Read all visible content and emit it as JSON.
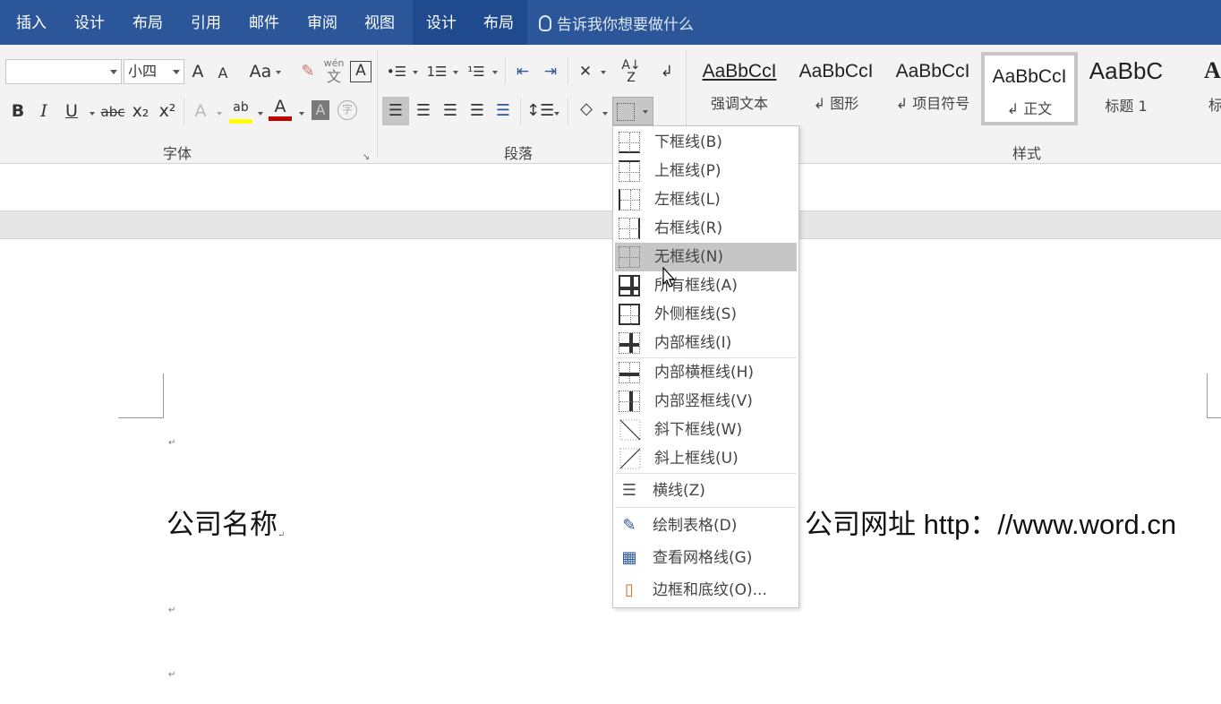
{
  "tabs": {
    "insert": "插入",
    "design": "设计",
    "layout": "布局",
    "references": "引用",
    "mailings": "邮件",
    "review": "审阅",
    "view": "视图",
    "table_design": "设计",
    "table_layout": "布局",
    "tell_me": "告诉我你想要做什么"
  },
  "ribbon": {
    "font_name": "",
    "font_size": "小四",
    "groups": {
      "font": "字体",
      "paragraph": "段落",
      "styles": "样式"
    },
    "font_buttons": {
      "bold": "B",
      "italic": "I",
      "underline": "U",
      "strike": "abc",
      "subscript": "x₂",
      "superscript": "x²",
      "grow": "A",
      "shrink": "A",
      "change_case": "Aa",
      "phonetic_top": "wén",
      "phonetic_bottom": "文",
      "char_border": "A",
      "text_effect": "A",
      "highlight": "ab",
      "font_color": "A",
      "char_shading": "A",
      "enclose": "字"
    }
  },
  "styles": [
    {
      "sample": "AaBbCcI",
      "name": "强调文本",
      "selected": false
    },
    {
      "sample": "AaBbCcI",
      "name": "↲ 图形",
      "selected": false
    },
    {
      "sample": "AaBbCcI",
      "name": "↲ 项目符号",
      "selected": false
    },
    {
      "sample": "AaBbCcI",
      "name": "↲ 正文",
      "selected": true
    },
    {
      "sample": "AaBbC",
      "name": "标题 1",
      "selected": false
    },
    {
      "sample": "AaI",
      "name": "标题",
      "selected": false
    }
  ],
  "border_menu": {
    "items": [
      {
        "label": "下框线(B)",
        "icon": "bottom-border-icon"
      },
      {
        "label": "上框线(P)",
        "icon": "top-border-icon"
      },
      {
        "label": "左框线(L)",
        "icon": "left-border-icon"
      },
      {
        "label": "右框线(R)",
        "icon": "right-border-icon"
      },
      {
        "label": "无框线(N)",
        "icon": "no-border-icon",
        "highlighted": true
      },
      {
        "label": "所有框线(A)",
        "icon": "all-borders-icon"
      },
      {
        "label": "外侧框线(S)",
        "icon": "outside-borders-icon"
      },
      {
        "label": "内部框线(I)",
        "icon": "inside-borders-icon"
      },
      {
        "label": "内部横框线(H)",
        "icon": "inside-horizontal-border-icon"
      },
      {
        "label": "内部竖框线(V)",
        "icon": "inside-vertical-border-icon"
      },
      {
        "label": "斜下框线(W)",
        "icon": "diagonal-down-border-icon"
      },
      {
        "label": "斜上框线(U)",
        "icon": "diagonal-up-border-icon"
      },
      {
        "label": "横线(Z)",
        "icon": "horizontal-line-icon"
      },
      {
        "label": "绘制表格(D)",
        "icon": "draw-table-icon"
      },
      {
        "label": "查看网格线(G)",
        "icon": "view-gridlines-icon"
      },
      {
        "label": "边框和底纹(O)...",
        "icon": "borders-shading-icon"
      }
    ]
  },
  "document": {
    "company_name": "公司名称",
    "company_site_label": "公司网址",
    "company_site_url": " http：//www.word.cn",
    "para_mark": "↵"
  },
  "colors": {
    "title_bar": "#2b579a",
    "ribbon_bg": "#f3f3f3",
    "menu_highlight": "#c6c6c6",
    "highlight_yellow": "#ffff00",
    "font_red": "#c00000"
  }
}
